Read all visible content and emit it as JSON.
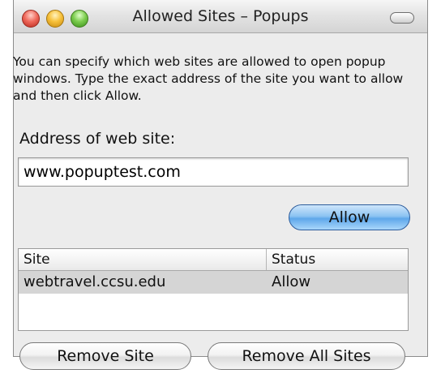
{
  "window": {
    "title": "Allowed Sites – Popups"
  },
  "description": "You can specify which web sites are allowed to open popup windows. Type the exact address of the site you want to allow and then click Allow.",
  "address": {
    "label": "Address of web site:",
    "value": "www.popuptest.com"
  },
  "allow_button": "Allow",
  "table": {
    "columns": [
      "Site",
      "Status"
    ],
    "rows": [
      {
        "site": "webtravel.ccsu.edu",
        "status": "Allow"
      }
    ]
  },
  "buttons": {
    "remove_site": "Remove Site",
    "remove_all": "Remove All Sites"
  }
}
